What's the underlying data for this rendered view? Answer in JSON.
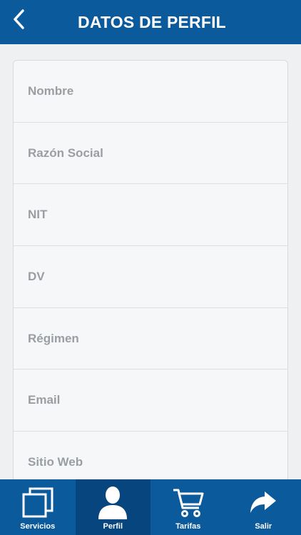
{
  "header": {
    "title": "DATOS DE PERFIL",
    "back_icon": "chevron-left-icon"
  },
  "form": {
    "fields": [
      {
        "placeholder": "Nombre"
      },
      {
        "placeholder": "Razón Social"
      },
      {
        "placeholder": "NIT"
      },
      {
        "placeholder": "DV"
      },
      {
        "placeholder": "Régimen"
      },
      {
        "placeholder": "Email"
      },
      {
        "placeholder": "Sitio Web"
      }
    ]
  },
  "tabbar": {
    "tabs": [
      {
        "label": "Servicios",
        "icon": "copy-icon",
        "active": false
      },
      {
        "label": "Perfil",
        "icon": "user-icon",
        "active": true
      },
      {
        "label": "Tarifas",
        "icon": "cart-icon",
        "active": false
      },
      {
        "label": "Salir",
        "icon": "share-arrow-icon",
        "active": false
      }
    ]
  },
  "colors": {
    "primary": "#0b5a9c",
    "active_tab": "#06457d",
    "placeholder_text": "#9a9ea3"
  }
}
